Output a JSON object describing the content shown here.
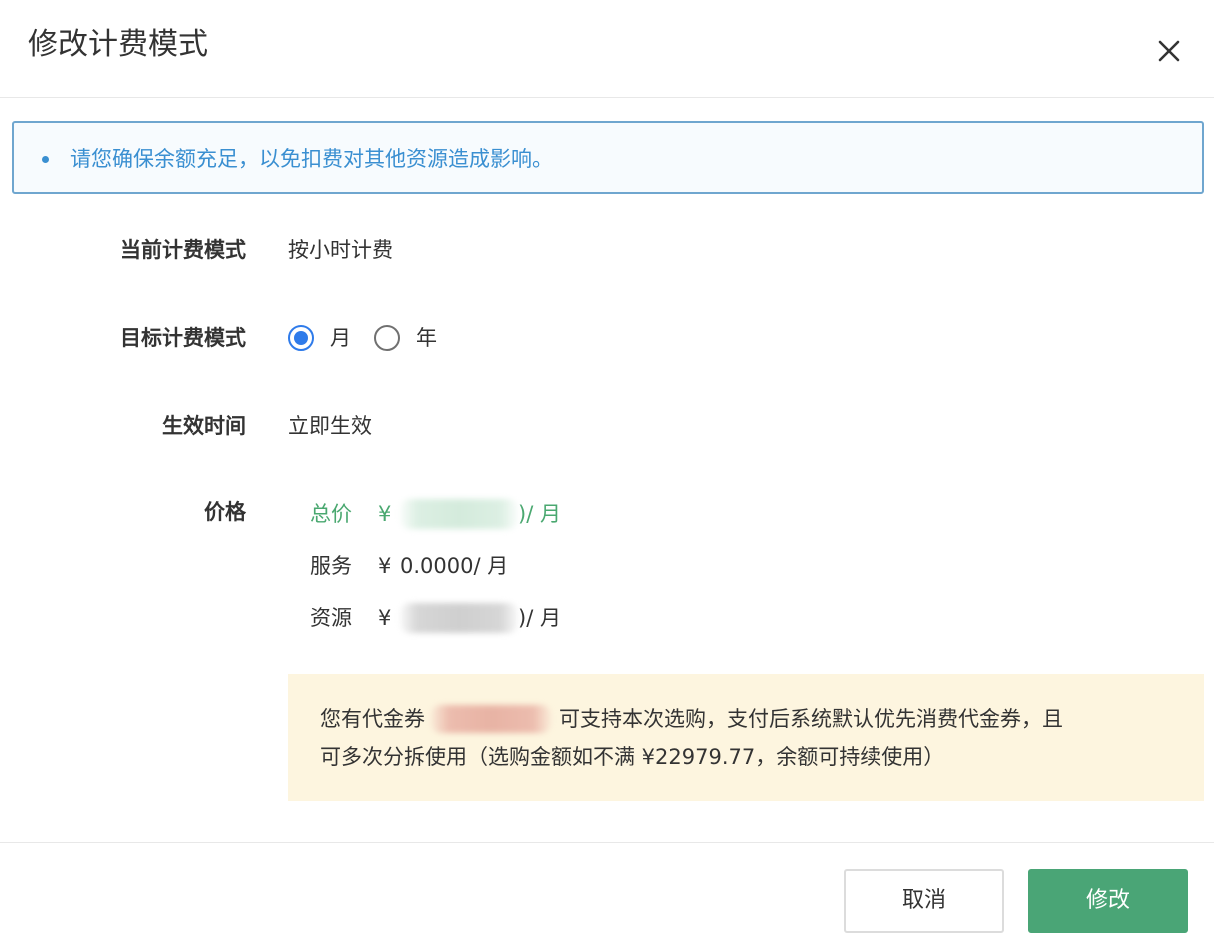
{
  "dialog": {
    "title": "修改计费模式",
    "close_icon": "close-icon"
  },
  "alert": {
    "text": "请您确保余额充足，以免扣费对其他资源造成影响。"
  },
  "form": {
    "current_mode": {
      "label": "当前计费模式",
      "value": "按小时计费"
    },
    "target_mode": {
      "label": "目标计费模式",
      "options": [
        {
          "label": "月",
          "checked": true
        },
        {
          "label": "年",
          "checked": false
        }
      ]
    },
    "effective_time": {
      "label": "生效时间",
      "value": "立即生效"
    },
    "price": {
      "label": "价格",
      "total": {
        "name": "总价",
        "symbol": "¥",
        "value_tail": ")",
        "unit": " / 月"
      },
      "service": {
        "name": "服务",
        "symbol": "¥",
        "value": "0.0000",
        "unit": " / 月"
      },
      "resource": {
        "name": "资源",
        "symbol": "¥",
        "value_tail": ")",
        "unit": " / 月"
      }
    }
  },
  "voucher": {
    "prefix": "您有代金券",
    "line1_suffix": "可支持本次选购，支付后系统默认优先消费代金券，且",
    "line2": "可多次分拆使用（选购金额如不满 ¥22979.77，余额可持续使用）"
  },
  "footer": {
    "cancel_label": "取消",
    "confirm_label": "修改"
  },
  "colors": {
    "accent_blue": "#2f7bea",
    "alert_blue": "#3a8fd1",
    "price_green": "#4aa870",
    "confirm_green": "#4aa576",
    "voucher_bg": "#fdf5df"
  }
}
